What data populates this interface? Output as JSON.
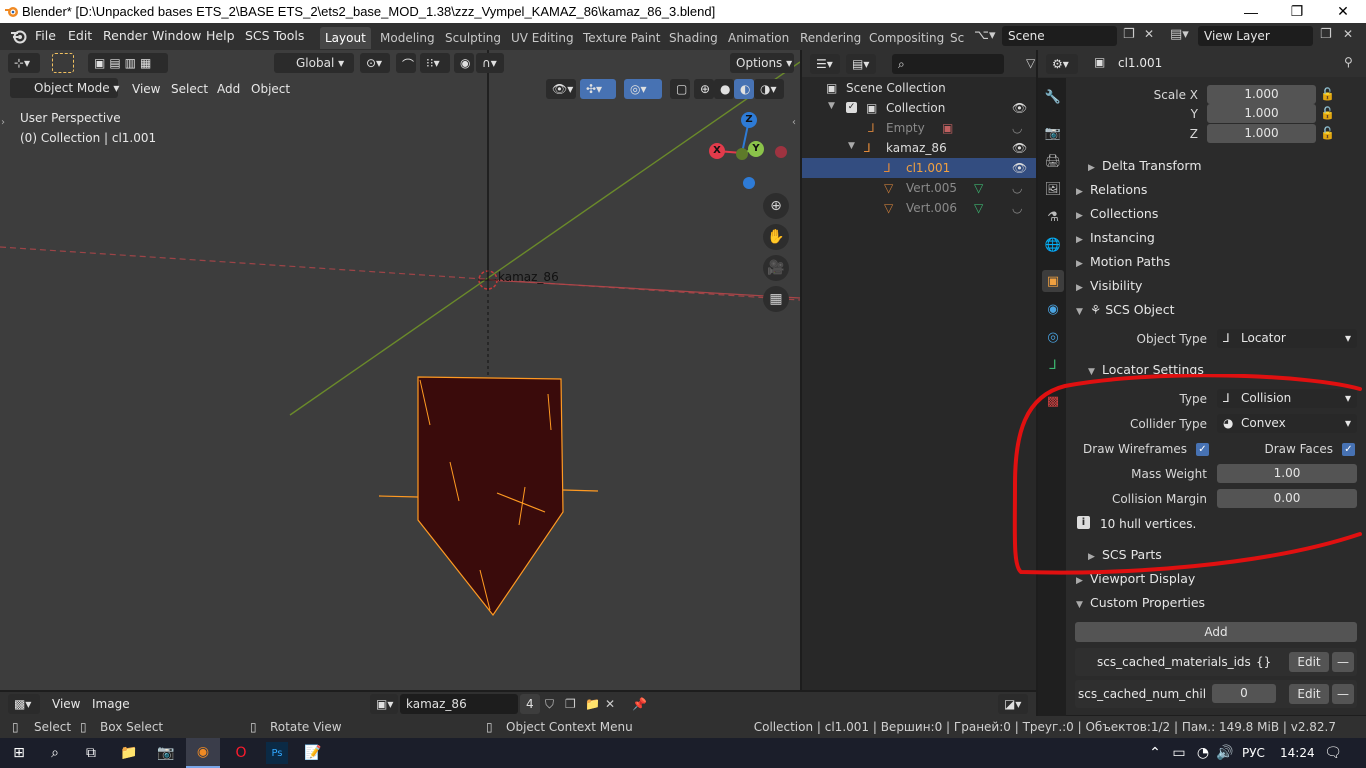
{
  "window": {
    "title": "Blender* [D:\\Unpacked bases ETS_2\\BASE ETS_2\\ets2_base_MOD_1.38\\zzz_Vympel_KAMAZ_86\\kamaz_86_3.blend]",
    "minimize": "—",
    "maximize": "❐",
    "close": "✕"
  },
  "menu": [
    "File",
    "Edit",
    "Render",
    "Window",
    "Help",
    "SCS Tools"
  ],
  "workspace_tabs": [
    "Layout",
    "Modeling",
    "Sculpting",
    "UV Editing",
    "Texture Paint",
    "Shading",
    "Animation",
    "Rendering",
    "Compositing",
    "Sc"
  ],
  "scene": {
    "value": "Scene",
    "view_layer": "View Layer"
  },
  "viewport": {
    "toolbar": {
      "orientation": "Global",
      "options": "Options"
    },
    "header": {
      "mode": "Object Mode",
      "menus": [
        "View",
        "Select",
        "Add",
        "Object"
      ]
    },
    "overlay_text": {
      "line1": "User Perspective",
      "line2": "(0) Collection | cl1.001"
    },
    "object_label": "kamaz_86",
    "gizmo": {
      "x": "X",
      "y": "Y",
      "z": "Z"
    },
    "colors": {
      "background": "#3d3d3d",
      "x_axis": "#b5464a",
      "y_axis": "#6a8a2a",
      "mesh_fill": "#3a0b0b",
      "mesh_edge": "#ff9a22"
    }
  },
  "outliner": {
    "title": "Scene Collection",
    "rows": [
      {
        "label": "Collection"
      },
      {
        "label": "Empty"
      },
      {
        "label": "kamaz_86"
      },
      {
        "label": "cl1.001"
      },
      {
        "label": "Vert.005"
      },
      {
        "label": "Vert.006"
      }
    ]
  },
  "properties": {
    "object_name": "cl1.001",
    "scale": {
      "x_label": "Scale X",
      "y_label": "Y",
      "z_label": "Z",
      "x": "1.000",
      "y": "1.000",
      "z": "1.000"
    },
    "sections": {
      "delta_transform": "Delta Transform",
      "relations": "Relations",
      "collections": "Collections",
      "instancing": "Instancing",
      "motion_paths": "Motion Paths",
      "visibility": "Visibility",
      "scs_object": "SCS Object",
      "locator_settings": "Locator Settings",
      "scs_parts": "SCS Parts",
      "viewport_display": "Viewport Display",
      "custom_properties": "Custom Properties"
    },
    "object_type": {
      "label": "Object Type",
      "value": "Locator"
    },
    "locator": {
      "type_label": "Type",
      "type_value": "Collision",
      "collider_label": "Collider Type",
      "collider_value": "Convex",
      "draw_wireframes": "Draw Wireframes",
      "draw_faces": "Draw Faces",
      "mass_label": "Mass Weight",
      "mass_value": "1.00",
      "margin_label": "Collision Margin",
      "margin_value": "0.00",
      "info": "10 hull vertices."
    },
    "custom": {
      "add": "Add",
      "rows": [
        {
          "name": "scs_cached_materials_ids",
          "value": "{}",
          "edit": "Edit",
          "remove": "—"
        },
        {
          "name": "scs_cached_num_childr..",
          "value": "0",
          "edit": "Edit",
          "remove": "—"
        }
      ]
    }
  },
  "image_editor": {
    "menus": [
      "View",
      "Image"
    ],
    "image_name": "kamaz_86",
    "users": "4"
  },
  "status_bar": {
    "select": "Select",
    "box_select": "Box Select",
    "rotate": "Rotate View",
    "context_menu": "Object Context Menu",
    "stats": "Collection | cl1.001 | Вершин:0 | Граней:0 | Треуг.:0 | Объектов:1/2 | Пам.: 149.8 MiB | v2.82.7"
  },
  "taskbar": {
    "language": "РУС",
    "time": "14:24"
  }
}
